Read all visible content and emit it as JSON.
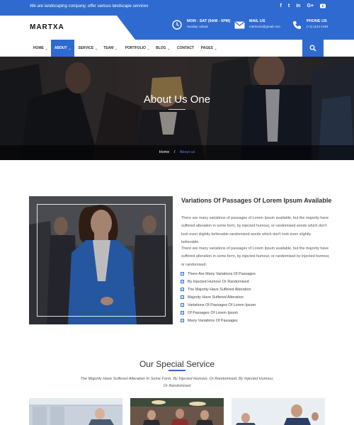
{
  "topbar": {
    "tagline": "We are landscaping company, offer various landscape services",
    "socials": [
      "f",
      "t",
      "in",
      "G+",
      "yt"
    ]
  },
  "header": {
    "logo": "MARTXA",
    "hours_title": "MON - SAT (9AM - 5PM)",
    "hours_sub": "Sunday colsed",
    "mail_title": "MAIL US",
    "mail_sub": "martxa15@gmail.com",
    "phone_title": "PHONE US",
    "phone_sub": "(+1) 1144-1294"
  },
  "nav": {
    "items": [
      "HOME",
      "ABOUT",
      "SERVICE",
      "TEAM",
      "PORTFOLIO",
      "BLOG",
      "CONTACT",
      "PAGES"
    ],
    "active": "ABOUT"
  },
  "hero": {
    "title": "About Us One",
    "crumb_home": "Home",
    "crumb_sep": "/",
    "crumb_current": "About us"
  },
  "about": {
    "heading": "Variations Of Passages Of Lorem Ipsum Available",
    "para1": "There are many variations of passages of Lorem Ipsum available, but the majority have suffered alteration in some form, by injected humour, or randomised words which don't look even slightly believable randomised words which don't look even slightly believable.",
    "para2": "There are many variations of passages of Lorem Ipsum available, but the majority have suffered alteration in some form, by injected humour, or randomised  by injected humour, or randomised.",
    "bullets": [
      "There Are Many Variations Of Passages",
      "By Injected Humour Or Randomised",
      "The Majority Have Suffered Alteration",
      "Majority Have Suffered Alteration",
      "Variations Of Passages Of Lorem Ipsum",
      "Of Passages Of Lorem Ipsum",
      "Many Variations Of Passages"
    ]
  },
  "services": {
    "title": "Our Special Service",
    "subtitle": "The Majority Have Suffered Alteration In Some Form, By Injected Humour, Or Randomised. By Injected Humour, Or Randomised"
  },
  "colors": {
    "brand": "#2f6ad0",
    "text": "#333333"
  }
}
